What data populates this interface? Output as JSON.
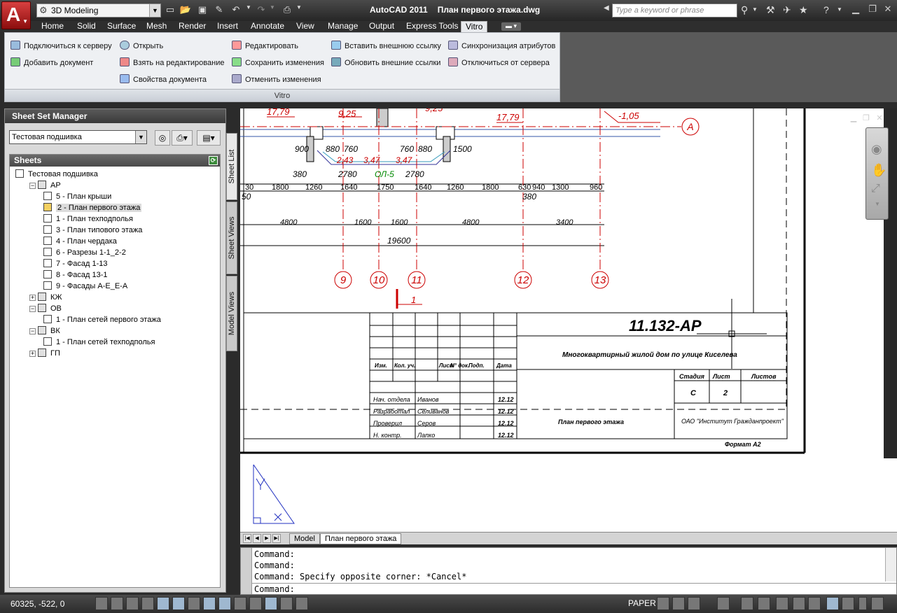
{
  "titlebar": {
    "workspace": "3D Modeling",
    "app_name": "AutoCAD 2011",
    "file_name": "План первого этажа.dwg",
    "search_placeholder": "Type a keyword or phrase"
  },
  "ribbon_tabs": [
    "Home",
    "Solid",
    "Surface",
    "Mesh",
    "Render",
    "Insert",
    "Annotate",
    "View",
    "Manage",
    "Output",
    "Express Tools",
    "Vitro"
  ],
  "active_tab": "Vitro",
  "ribbon": {
    "panel_label": "Vitro",
    "col1": [
      "Подключиться к серверу",
      "Добавить документ"
    ],
    "col2": [
      "Открыть",
      "Взять на редактирование",
      "Свойства документа"
    ],
    "col3": [
      "Редактировать",
      "Сохранить изменения",
      "Отменить изменения"
    ],
    "col4": [
      "Вставить внешнюю ссылку",
      "Обновить внешние ссылки"
    ],
    "col5": [
      "Синхронизация атрибутов",
      "Отключиться от сервера"
    ]
  },
  "ssm": {
    "title": "Sheet Set Manager",
    "selected_set": "Тестовая подшивка",
    "sheets_header": "Sheets",
    "tree": [
      {
        "label": "Тестовая подшивка",
        "level": 0,
        "type": "root"
      },
      {
        "label": "АР",
        "level": 1,
        "type": "group",
        "expanded": true
      },
      {
        "label": "5 - План крыши",
        "level": 2,
        "type": "sheet"
      },
      {
        "label": "2 - План первого этажа",
        "level": 2,
        "type": "sheet-locked",
        "selected": true
      },
      {
        "label": "1 - План техподполья",
        "level": 2,
        "type": "sheet"
      },
      {
        "label": "3 - План типового этажа",
        "level": 2,
        "type": "sheet"
      },
      {
        "label": "4 - План чердака",
        "level": 2,
        "type": "sheet"
      },
      {
        "label": "6 - Разрезы 1-1_2-2",
        "level": 2,
        "type": "sheet"
      },
      {
        "label": "7 - Фасад 1-13",
        "level": 2,
        "type": "sheet"
      },
      {
        "label": "8 - Фасад 13-1",
        "level": 2,
        "type": "sheet"
      },
      {
        "label": "9 - Фасады А-Е_Е-А",
        "level": 2,
        "type": "sheet"
      },
      {
        "label": "КЖ",
        "level": 1,
        "type": "group"
      },
      {
        "label": "ОВ",
        "level": 1,
        "type": "group",
        "expanded": true
      },
      {
        "label": "1 - План сетей первого этажа",
        "level": 2,
        "type": "sheet"
      },
      {
        "label": "ВК",
        "level": 1,
        "type": "group",
        "expanded": true
      },
      {
        "label": "1 - План сетей техподполья",
        "level": 2,
        "type": "sheet"
      },
      {
        "label": "ГП",
        "level": 1,
        "type": "group"
      }
    ],
    "vertical_tabs": [
      "Sheet List",
      "Sheet Views",
      "Model Views"
    ]
  },
  "drawing": {
    "dim_top_row": [
      "30",
      "1800",
      "1260",
      "1640",
      "1750",
      "1640",
      "1260",
      "1800",
      "630",
      "940",
      "1300",
      "960"
    ],
    "dim_mid_row": [
      "4800",
      "1600",
      "1600",
      "4800",
      "3400"
    ],
    "dim_total": "19600",
    "upper_labels": [
      "900",
      "880",
      "760",
      "2,43",
      "3,47",
      "3,47",
      "760",
      "880",
      "1500",
      "380",
      "2780",
      "ОЛ-5",
      "2780",
      "380",
      "50"
    ],
    "top_red": [
      "17,79",
      "9,25",
      "9,25",
      "17,79",
      "-1,05"
    ],
    "axes": [
      "9",
      "10",
      "11",
      "12",
      "13"
    ],
    "axis_row": "А",
    "section_mark": "1",
    "stamp": {
      "code": "11.132-АР",
      "project": "Многоквартирный жилой дом по улице Киселева",
      "table_headers": [
        "Изм.",
        "Кол. уч.",
        "Лист",
        "N° док.",
        "Подп.",
        "Дата"
      ],
      "people": [
        {
          "role": "Нач. отдела",
          "name": "Иванов",
          "date": "12.12"
        },
        {
          "role": "Разработал",
          "name": "Селиванов",
          "date": "12.12"
        },
        {
          "role": "Проверил",
          "name": "Серов",
          "date": "12.12"
        },
        {
          "role": "Н. контр.",
          "name": "Лапко",
          "date": "12.12"
        }
      ],
      "stage_headers": [
        "Стадия",
        "Лист",
        "Листов"
      ],
      "stage_values": [
        "С",
        "2",
        ""
      ],
      "sheet_title": "План первого этажа",
      "org": "ОАО \"Институт Гражданпроект\"",
      "format": "Формат А2"
    }
  },
  "layout_tabs": [
    "Model",
    "План первого этажа"
  ],
  "active_layout": "План первого этажа",
  "command_history": [
    "Command:",
    "Command:",
    "Command: Specify opposite corner: *Cancel*"
  ],
  "command_prompt": "Command:",
  "status": {
    "coords": "60325, -522, 0",
    "space": "PAPER"
  },
  "colors": {
    "accent_red": "#d00000",
    "title_bg": "#2c2c2c",
    "ribbon_bg": "#eef0f3"
  }
}
